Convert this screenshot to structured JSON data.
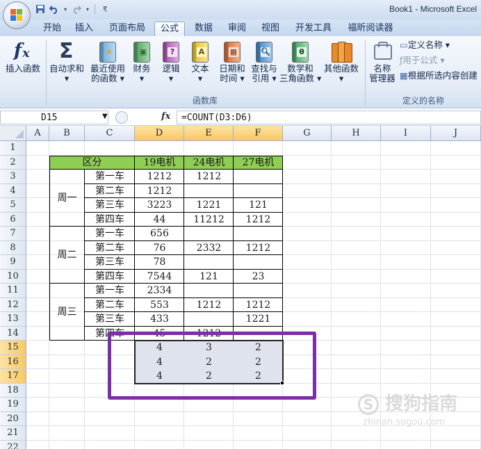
{
  "window": {
    "title": "Book1 - Microsoft Excel",
    "quick_access": [
      "save-icon",
      "undo-icon",
      "redo-icon"
    ]
  },
  "ribbon_tabs": [
    "开始",
    "插入",
    "页面布局",
    "公式",
    "数据",
    "审阅",
    "视图",
    "开发工具",
    "福昕阅读器"
  ],
  "active_tab": "公式",
  "ribbon": {
    "function_library": {
      "label": "函数库",
      "buttons": [
        {
          "line1": "插入函数",
          "line2": "",
          "icon": "fx-icon"
        },
        {
          "line1": "自动求和",
          "line2": "▾",
          "icon": "sigma-icon"
        },
        {
          "line1": "最近使用",
          "line2": "的函数 ▾",
          "icon": "star-book-icon"
        },
        {
          "line1": "财务",
          "line2": "▾",
          "icon": "finance-book-icon"
        },
        {
          "line1": "逻辑",
          "line2": "▾",
          "icon": "logic-book-icon"
        },
        {
          "line1": "文本",
          "line2": "▾",
          "icon": "text-book-icon"
        },
        {
          "line1": "日期和",
          "line2": "时间 ▾",
          "icon": "calendar-book-icon"
        },
        {
          "line1": "查找与",
          "line2": "引用 ▾",
          "icon": "lookup-book-icon"
        },
        {
          "line1": "数学和",
          "line2": "三角函数 ▾",
          "icon": "theta-book-icon"
        },
        {
          "line1": "其他函数",
          "line2": "▾",
          "icon": "more-books-icon"
        }
      ]
    },
    "defined_names": {
      "label": "定义的名称",
      "name_manager": {
        "line1": "名称",
        "line2": "管理器"
      },
      "define_name": "定义名称 ▾",
      "use_in_formula": "用于公式 ▾",
      "create_from_selection": "根据所选内容创建"
    }
  },
  "formula_bar": {
    "name_box": "D15",
    "fx_label": "fx",
    "formula": "=COUNT(D3:D6)"
  },
  "columns": [
    "A",
    "B",
    "C",
    "D",
    "E",
    "F",
    "G",
    "H",
    "I",
    "J"
  ],
  "rows": [
    "1",
    "2",
    "3",
    "4",
    "5",
    "6",
    "7",
    "8",
    "9",
    "10",
    "11",
    "12",
    "13",
    "14",
    "15",
    "16",
    "17",
    "18",
    "19",
    "20",
    "21",
    "22"
  ],
  "table": {
    "header": [
      "区分",
      "19电机",
      "24电机",
      "27电机"
    ],
    "groups": [
      "周一",
      "周二",
      "周三"
    ],
    "body": [
      [
        "第一车",
        "1212",
        "1212",
        ""
      ],
      [
        "第二车",
        "1212",
        "",
        ""
      ],
      [
        "第三车",
        "3223",
        "1221",
        "121"
      ],
      [
        "第四车",
        "44",
        "11212",
        "1212"
      ],
      [
        "第一车",
        "656",
        "",
        ""
      ],
      [
        "第二车",
        "76",
        "2332",
        "1212"
      ],
      [
        "第三车",
        "78",
        "",
        ""
      ],
      [
        "第四车",
        "7544",
        "121",
        "23"
      ],
      [
        "第一车",
        "2334",
        "",
        ""
      ],
      [
        "第二车",
        "553",
        "1212",
        "1212"
      ],
      [
        "第三车",
        "433",
        "",
        "1221"
      ],
      [
        "第四车",
        "45",
        "1212",
        ""
      ]
    ],
    "counts": [
      [
        "4",
        "3",
        "2"
      ],
      [
        "4",
        "2",
        "2"
      ],
      [
        "4",
        "2",
        "2"
      ]
    ]
  },
  "watermark": {
    "line1": "搜狗指南",
    "line2": "zhinan.sogou.com"
  },
  "colors": {
    "header_fill": "#8fce54",
    "selection_fill": "#dfe3ee",
    "annotation": "#7a2ea8",
    "selected_header": "#f8c867"
  }
}
